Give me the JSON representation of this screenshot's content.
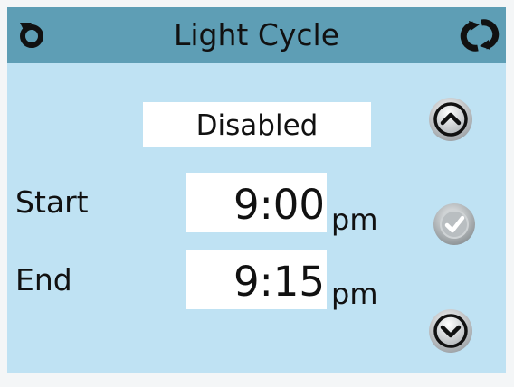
{
  "header": {
    "title": "Light Cycle",
    "back_icon": "back-arrow-icon",
    "refresh_icon": "refresh-icon"
  },
  "status": {
    "value": "Disabled"
  },
  "start": {
    "label": "Start",
    "time": "9:00",
    "ampm": "pm"
  },
  "end": {
    "label": "End",
    "time": "9:15",
    "ampm": "pm"
  },
  "controls": {
    "up_icon": "chevron-up-icon",
    "confirm_icon": "checkmark-icon",
    "down_icon": "chevron-down-icon"
  },
  "colors": {
    "header": "#5e9eb5",
    "background": "#bfe2f3",
    "field": "#ffffff"
  }
}
